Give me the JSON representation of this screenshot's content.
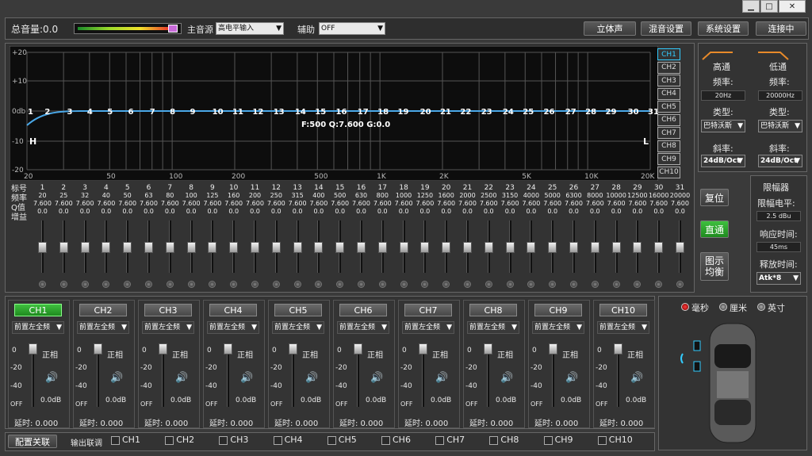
{
  "topbar": {
    "total_volume": "总音量:0.0",
    "main_source_label": "主音源",
    "main_source_value": "高电平输入",
    "aux_label": "辅助",
    "aux_value": "OFF",
    "buttons": [
      "立体声",
      "混音设置",
      "系统设置",
      "连接中"
    ]
  },
  "window_buttons": [
    "▁",
    "□",
    "✕"
  ],
  "graph": {
    "y_labels": [
      "+20",
      "+10",
      "0db",
      "-10",
      "-20"
    ],
    "x_labels": [
      "20",
      "50",
      "100",
      "200",
      "500",
      "1K",
      "2K",
      "5K",
      "10K",
      "20K"
    ],
    "points": [
      "1",
      "2",
      "3",
      "4",
      "5",
      "6",
      "7",
      "8",
      "9",
      "10",
      "11",
      "12",
      "13",
      "14",
      "15",
      "16",
      "17",
      "18",
      "19",
      "20",
      "21",
      "22",
      "23",
      "24",
      "25",
      "26",
      "27",
      "28",
      "29",
      "30",
      "31"
    ],
    "readout": "F:500 Q:7.600 G:0.0",
    "h_label": "H",
    "l_label": "L"
  },
  "channels_list": [
    "CH1",
    "CH2",
    "CH3",
    "CH4",
    "CH5",
    "CH6",
    "CH7",
    "CH8",
    "CH9",
    "CH10"
  ],
  "eq": {
    "row_labels": [
      "标号",
      "频率",
      "Q值",
      "增益"
    ],
    "bands": [
      {
        "n": "1",
        "f": "20",
        "q": "7.600",
        "g": "0.0"
      },
      {
        "n": "2",
        "f": "25",
        "q": "7.600",
        "g": "0.0"
      },
      {
        "n": "3",
        "f": "32",
        "q": "7.600",
        "g": "0.0"
      },
      {
        "n": "4",
        "f": "40",
        "q": "7.600",
        "g": "0.0"
      },
      {
        "n": "5",
        "f": "50",
        "q": "7.600",
        "g": "0.0"
      },
      {
        "n": "6",
        "f": "63",
        "q": "7.600",
        "g": "0.0"
      },
      {
        "n": "7",
        "f": "80",
        "q": "7.600",
        "g": "0.0"
      },
      {
        "n": "8",
        "f": "100",
        "q": "7.600",
        "g": "0.0"
      },
      {
        "n": "9",
        "f": "125",
        "q": "7.600",
        "g": "0.0"
      },
      {
        "n": "10",
        "f": "160",
        "q": "7.600",
        "g": "0.0"
      },
      {
        "n": "11",
        "f": "200",
        "q": "7.600",
        "g": "0.0"
      },
      {
        "n": "12",
        "f": "250",
        "q": "7.600",
        "g": "0.0"
      },
      {
        "n": "13",
        "f": "315",
        "q": "7.600",
        "g": "0.0"
      },
      {
        "n": "14",
        "f": "400",
        "q": "7.600",
        "g": "0.0"
      },
      {
        "n": "15",
        "f": "500",
        "q": "7.600",
        "g": "0.0"
      },
      {
        "n": "16",
        "f": "630",
        "q": "7.600",
        "g": "0.0"
      },
      {
        "n": "17",
        "f": "800",
        "q": "7.600",
        "g": "0.0"
      },
      {
        "n": "18",
        "f": "1000",
        "q": "7.600",
        "g": "0.0"
      },
      {
        "n": "19",
        "f": "1250",
        "q": "7.600",
        "g": "0.0"
      },
      {
        "n": "20",
        "f": "1600",
        "q": "7.600",
        "g": "0.0"
      },
      {
        "n": "21",
        "f": "2000",
        "q": "7.600",
        "g": "0.0"
      },
      {
        "n": "22",
        "f": "2500",
        "q": "7.600",
        "g": "0.0"
      },
      {
        "n": "23",
        "f": "3150",
        "q": "7.600",
        "g": "0.0"
      },
      {
        "n": "24",
        "f": "4000",
        "q": "7.600",
        "g": "0.0"
      },
      {
        "n": "25",
        "f": "5000",
        "q": "7.600",
        "g": "0.0"
      },
      {
        "n": "26",
        "f": "6300",
        "q": "7.600",
        "g": "0.0"
      },
      {
        "n": "27",
        "f": "8000",
        "q": "7.600",
        "g": "0.0"
      },
      {
        "n": "28",
        "f": "10000",
        "q": "7.600",
        "g": "0.0"
      },
      {
        "n": "29",
        "f": "12500",
        "q": "7.600",
        "g": "0.0"
      },
      {
        "n": "30",
        "f": "16000",
        "q": "7.600",
        "g": "0.0"
      },
      {
        "n": "31",
        "f": "20000",
        "q": "7.600",
        "g": "0.0"
      }
    ]
  },
  "side_buttons": {
    "reset": "复位",
    "bypass": "直通",
    "graphic_eq": "图示\n均衡"
  },
  "crossover": {
    "high": {
      "title": "高通",
      "freq_label": "频率:",
      "freq": "20Hz",
      "type_label": "类型:",
      "type": "巴特沃斯",
      "slope_label": "斜率:",
      "slope": "24dB/Oct"
    },
    "low": {
      "title": "低通",
      "freq_label": "频率:",
      "freq": "20000Hz",
      "type_label": "类型:",
      "type": "巴特沃斯",
      "slope_label": "斜率:",
      "slope": "24dB/Oct"
    }
  },
  "limiter": {
    "title": "限幅器",
    "level_label": "限幅电平:",
    "level": "2.5 dBu",
    "response_label": "响应时间:",
    "response": "45ms",
    "release_label": "释放时间:",
    "release": "Atk*8"
  },
  "out_channels": [
    {
      "name": "CH1",
      "src": "前置左全频",
      "phase": "正相",
      "gain": "0.0dB",
      "delay": "延时:  0.000"
    },
    {
      "name": "CH2",
      "src": "前置左全频",
      "phase": "正相",
      "gain": "0.0dB",
      "delay": "延时:  0.000"
    },
    {
      "name": "CH3",
      "src": "前置左全频",
      "phase": "正相",
      "gain": "0.0dB",
      "delay": "延时:  0.000"
    },
    {
      "name": "CH4",
      "src": "前置左全频",
      "phase": "正相",
      "gain": "0.0dB",
      "delay": "延时:  0.000"
    },
    {
      "name": "CH5",
      "src": "前置左全频",
      "phase": "正相",
      "gain": "0.0dB",
      "delay": "延时:  0.000"
    },
    {
      "name": "CH6",
      "src": "前置左全频",
      "phase": "正相",
      "gain": "0.0dB",
      "delay": "延时:  0.000"
    },
    {
      "name": "CH7",
      "src": "前置左全频",
      "phase": "正相",
      "gain": "0.0dB",
      "delay": "延时:  0.000"
    },
    {
      "name": "CH8",
      "src": "前置左全频",
      "phase": "正相",
      "gain": "0.0dB",
      "delay": "延时:  0.000"
    },
    {
      "name": "CH9",
      "src": "前置左全频",
      "phase": "正相",
      "gain": "0.0dB",
      "delay": "延时:  0.000"
    },
    {
      "name": "CH10",
      "src": "前置左全频",
      "phase": "正相",
      "gain": "0.0dB",
      "delay": "延时:  0.000"
    }
  ],
  "fader_scale": [
    "0",
    "-20",
    "-40",
    "OFF"
  ],
  "units": {
    "ms": "毫秒",
    "cm": "厘米",
    "inch": "英寸"
  },
  "bottom": {
    "lock": "配置关联",
    "link_label": "输出联调",
    "links": [
      "CH1",
      "CH2",
      "CH3",
      "CH4",
      "CH5",
      "CH6",
      "CH7",
      "CH8",
      "CH9",
      "CH10"
    ]
  }
}
